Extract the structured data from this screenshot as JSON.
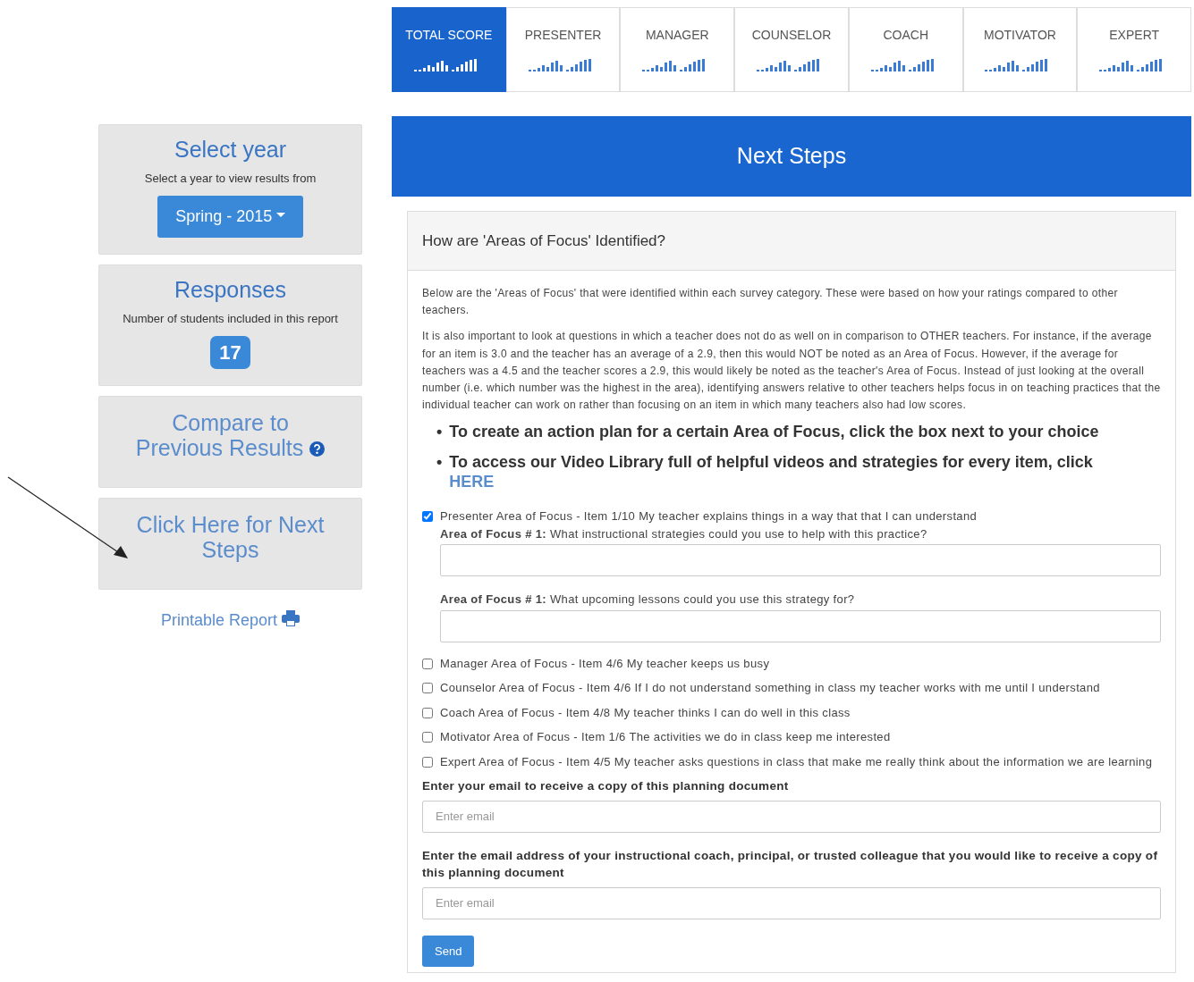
{
  "tabs": [
    {
      "label": "TOTAL SCORE",
      "selected": true
    },
    {
      "label": "PRESENTER",
      "selected": false
    },
    {
      "label": "MANAGER",
      "selected": false
    },
    {
      "label": "COUNSELOR",
      "selected": false
    },
    {
      "label": "COACH",
      "selected": false
    },
    {
      "label": "MOTIVATOR",
      "selected": false
    },
    {
      "label": "EXPERT",
      "selected": false
    }
  ],
  "sidebar": {
    "year": {
      "title": "Select year",
      "subtitle": "Select a year to view results from",
      "dropdown": "Spring - 2015"
    },
    "responses": {
      "title": "Responses",
      "subtitle": "Number of students included in this report",
      "count": "17"
    },
    "compare": {
      "title": "Compare to Previous Results"
    },
    "next_steps": {
      "title": "Click Here for Next Steps"
    },
    "printable_report": "Printable Report"
  },
  "main": {
    "header": "Next Steps",
    "panel_title": "How are 'Areas of Focus' Identified?",
    "paragraphs": [
      "Below are the 'Areas of Focus' that were identified within each survey category. These were based on how your ratings compared to other teachers.",
      "It is also important to look at questions in which a teacher does not do as well on in comparison to OTHER teachers.  For instance, if the average for an item is 3.0 and the teacher has an average of a 2.9, then this would NOT be noted as an Area of Focus.  However, if the average for teachers was a 4.5 and the teacher scores a 2.9, this would likely be noted as the teacher's Area of Focus.  Instead of just looking at the overall number (i.e. which number was the highest in the area), identifying answers relative to other teachers helps focus in on teaching practices that the individual teacher can work on rather than focusing on an item in which many teachers also had low scores."
    ],
    "bullets": [
      {
        "marker": "•",
        "text": "To create an action plan for a certain Area of Focus, click the box next to your choice"
      },
      {
        "marker": "•",
        "text": "To access our Video Library full of helpful videos and strategies for every item, click",
        "link": "HERE"
      }
    ],
    "focus_items": [
      {
        "label": "Presenter Area of Focus - Item 1/10 My teacher explains things in a way that that I can understand",
        "checked": true,
        "questions": [
          "**Area of Focus # 1:** What instructional strategies could you use to help with this practice?",
          "**Area of Focus # 1:** What upcoming lessons could you use this strategy for?"
        ]
      },
      {
        "label": "Manager Area of Focus - Item 4/6 My teacher keeps us busy",
        "checked": false
      },
      {
        "label": "Counselor Area of Focus - Item 4/6 If I do not understand something in class my teacher works with me until I understand",
        "checked": false
      },
      {
        "label": "Coach Area of Focus - Item 4/8 My teacher thinks I can do well in this class",
        "checked": false
      },
      {
        "label": "Motivator Area of Focus - Item 1/6 The activities we do in class keep me interested",
        "checked": false
      },
      {
        "label": "Expert Area of Focus - Item 4/5 My teacher asks questions in class that make me really think about the information we are learning",
        "checked": false
      }
    ],
    "email_fields": [
      {
        "label": "Enter your email to receive a copy of this planning document",
        "placeholder": "Enter email"
      },
      {
        "label": "Enter the email address of your instructional coach, principal, or trusted colleague that you would like to receive a copy of this planning document",
        "placeholder": "Enter email"
      }
    ],
    "send_button": "Send"
  }
}
